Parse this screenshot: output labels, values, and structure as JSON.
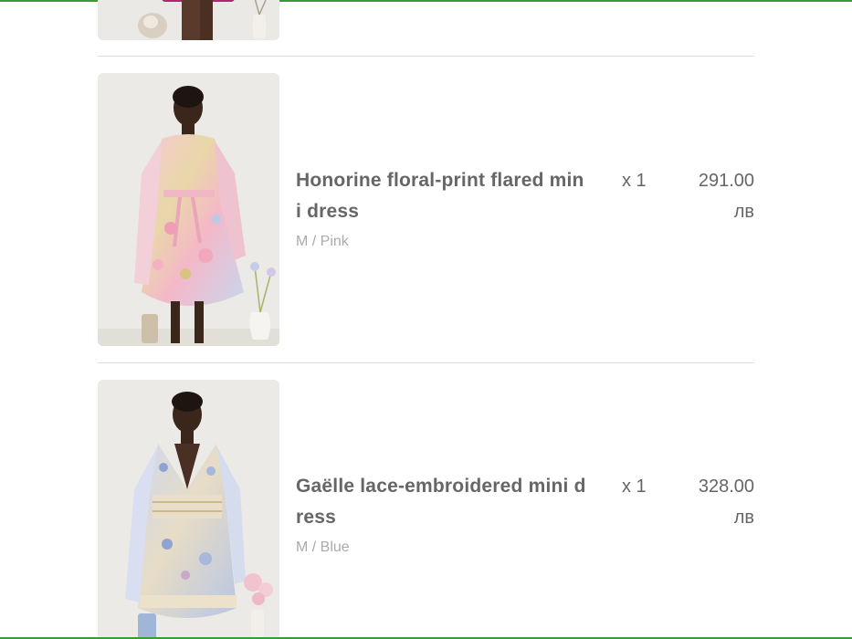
{
  "colors": {
    "accent": "#3a9a3a",
    "text_primary": "#666666",
    "text_muted": "#aaaaaa",
    "divider": "#dddddd"
  },
  "items": [
    {
      "image_label": "partial-dress-image",
      "title": "",
      "variant": "",
      "qty": "",
      "price": "",
      "currency": ""
    },
    {
      "image_label": "honorine-dress-image",
      "title": "Honorine floral-print flared mini dress",
      "variant": "M / Pink",
      "qty": "x 1",
      "price": "291.00",
      "currency": "лв"
    },
    {
      "image_label": "gaelle-dress-image",
      "title": "Gaëlle lace-embroidered mini dress",
      "variant": "M / Blue",
      "qty": "x 1",
      "price": "328.00",
      "currency": "лв"
    }
  ]
}
